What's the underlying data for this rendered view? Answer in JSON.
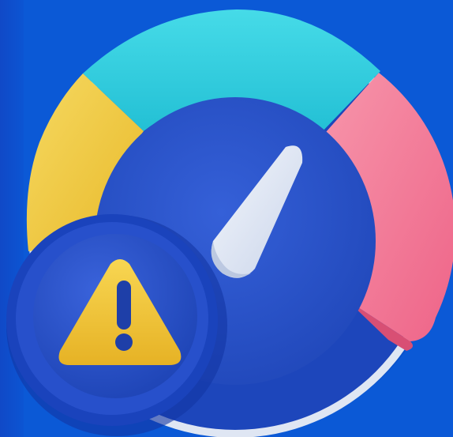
{
  "scene": {
    "subject": "speedometer-gauge-with-warning-badge",
    "colors": {
      "background": "#0b59d6",
      "dial_face": "#2a54c9",
      "segment_low": "#f2cd45",
      "segment_mid": "#33d4e3",
      "segment_high": "#f47e9a",
      "needle": "#dfe6f3",
      "badge_ring": "#1c45bd",
      "badge_face": "#2b56cf",
      "warning_triangle": "#f2c63d",
      "warning_mark": "#1e3fa8"
    },
    "gauge": {
      "segments": [
        "low",
        "mid",
        "high"
      ]
    },
    "icons": [
      "gauge-icon",
      "warning-icon"
    ]
  }
}
